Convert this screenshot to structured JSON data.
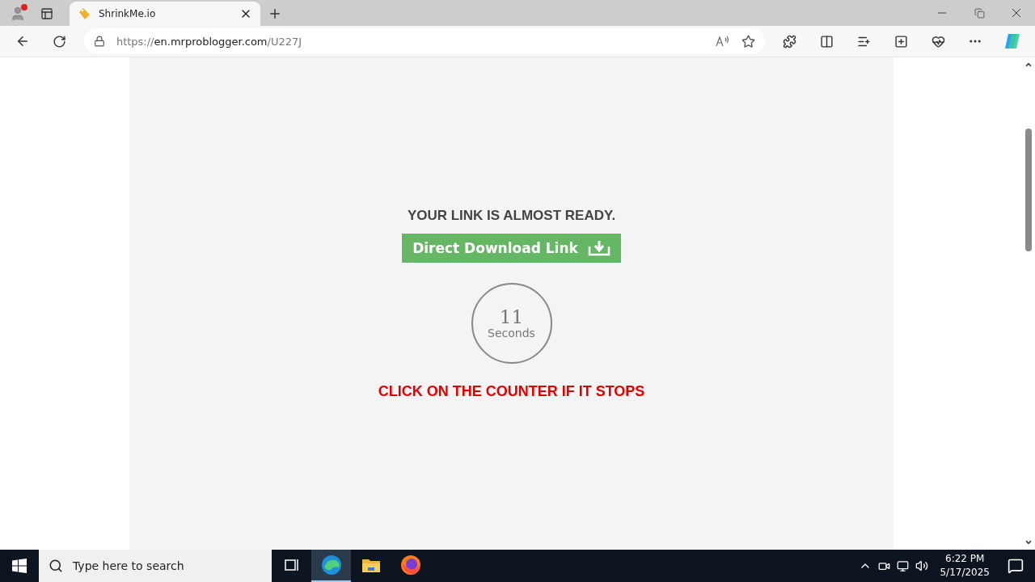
{
  "browser": {
    "tab": {
      "title": "ShrinkMe.io",
      "selected": true
    },
    "address": {
      "scheme": "https://",
      "host": "en.mrproblogger.com",
      "path": "/U227J"
    }
  },
  "page": {
    "heading": "YOUR LINK IS ALMOST READY.",
    "button": "Direct Download Link",
    "counter": {
      "number": "11",
      "unit": "Seconds"
    },
    "warning": "CLICK ON THE COUNTER IF IT STOPS"
  },
  "taskbar": {
    "search": {
      "placeholder": "Type here to search"
    },
    "apps": [
      {
        "kind": "taskview",
        "selected": false
      },
      {
        "kind": "edge",
        "selected": true
      },
      {
        "kind": "folder",
        "selected": false
      },
      {
        "kind": "firefox",
        "selected": false
      }
    ],
    "time": "6:22 PM",
    "date": "5/17/2025"
  }
}
